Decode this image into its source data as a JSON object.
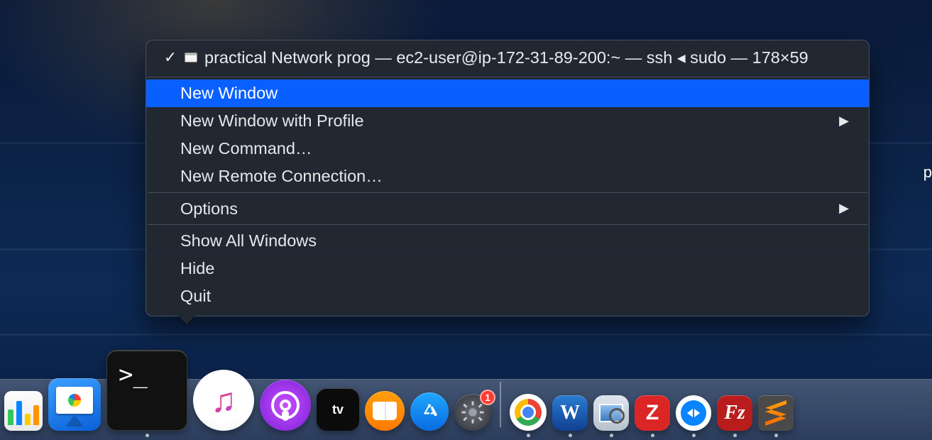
{
  "menu": {
    "header_title": "practical Network prog — ec2-user@ip-172-31-89-200:~ — ssh ◂ sudo — 178×59",
    "items": {
      "new_window": "New Window",
      "new_window_profile": "New Window with Profile",
      "new_command": "New Command…",
      "new_remote": "New Remote Connection…",
      "options": "Options",
      "show_all": "Show All Windows",
      "hide": "Hide",
      "quit": "Quit"
    }
  },
  "dock": {
    "badge_settings": "1",
    "apps": {
      "numbers": "Numbers",
      "keynote": "Keynote",
      "terminal": "Terminal",
      "music": "Music",
      "podcasts": "Podcasts",
      "appletv": "tv",
      "books": "Books",
      "appstore": "App Store",
      "settings": "System Preferences",
      "chrome": "Google Chrome",
      "word": "W",
      "preview": "Preview",
      "zotero": "Z",
      "teamviewer": "TeamViewer",
      "filezilla": "Fz",
      "sublime": "Sublime Text"
    }
  },
  "bg": {
    "partial_char": "p"
  }
}
